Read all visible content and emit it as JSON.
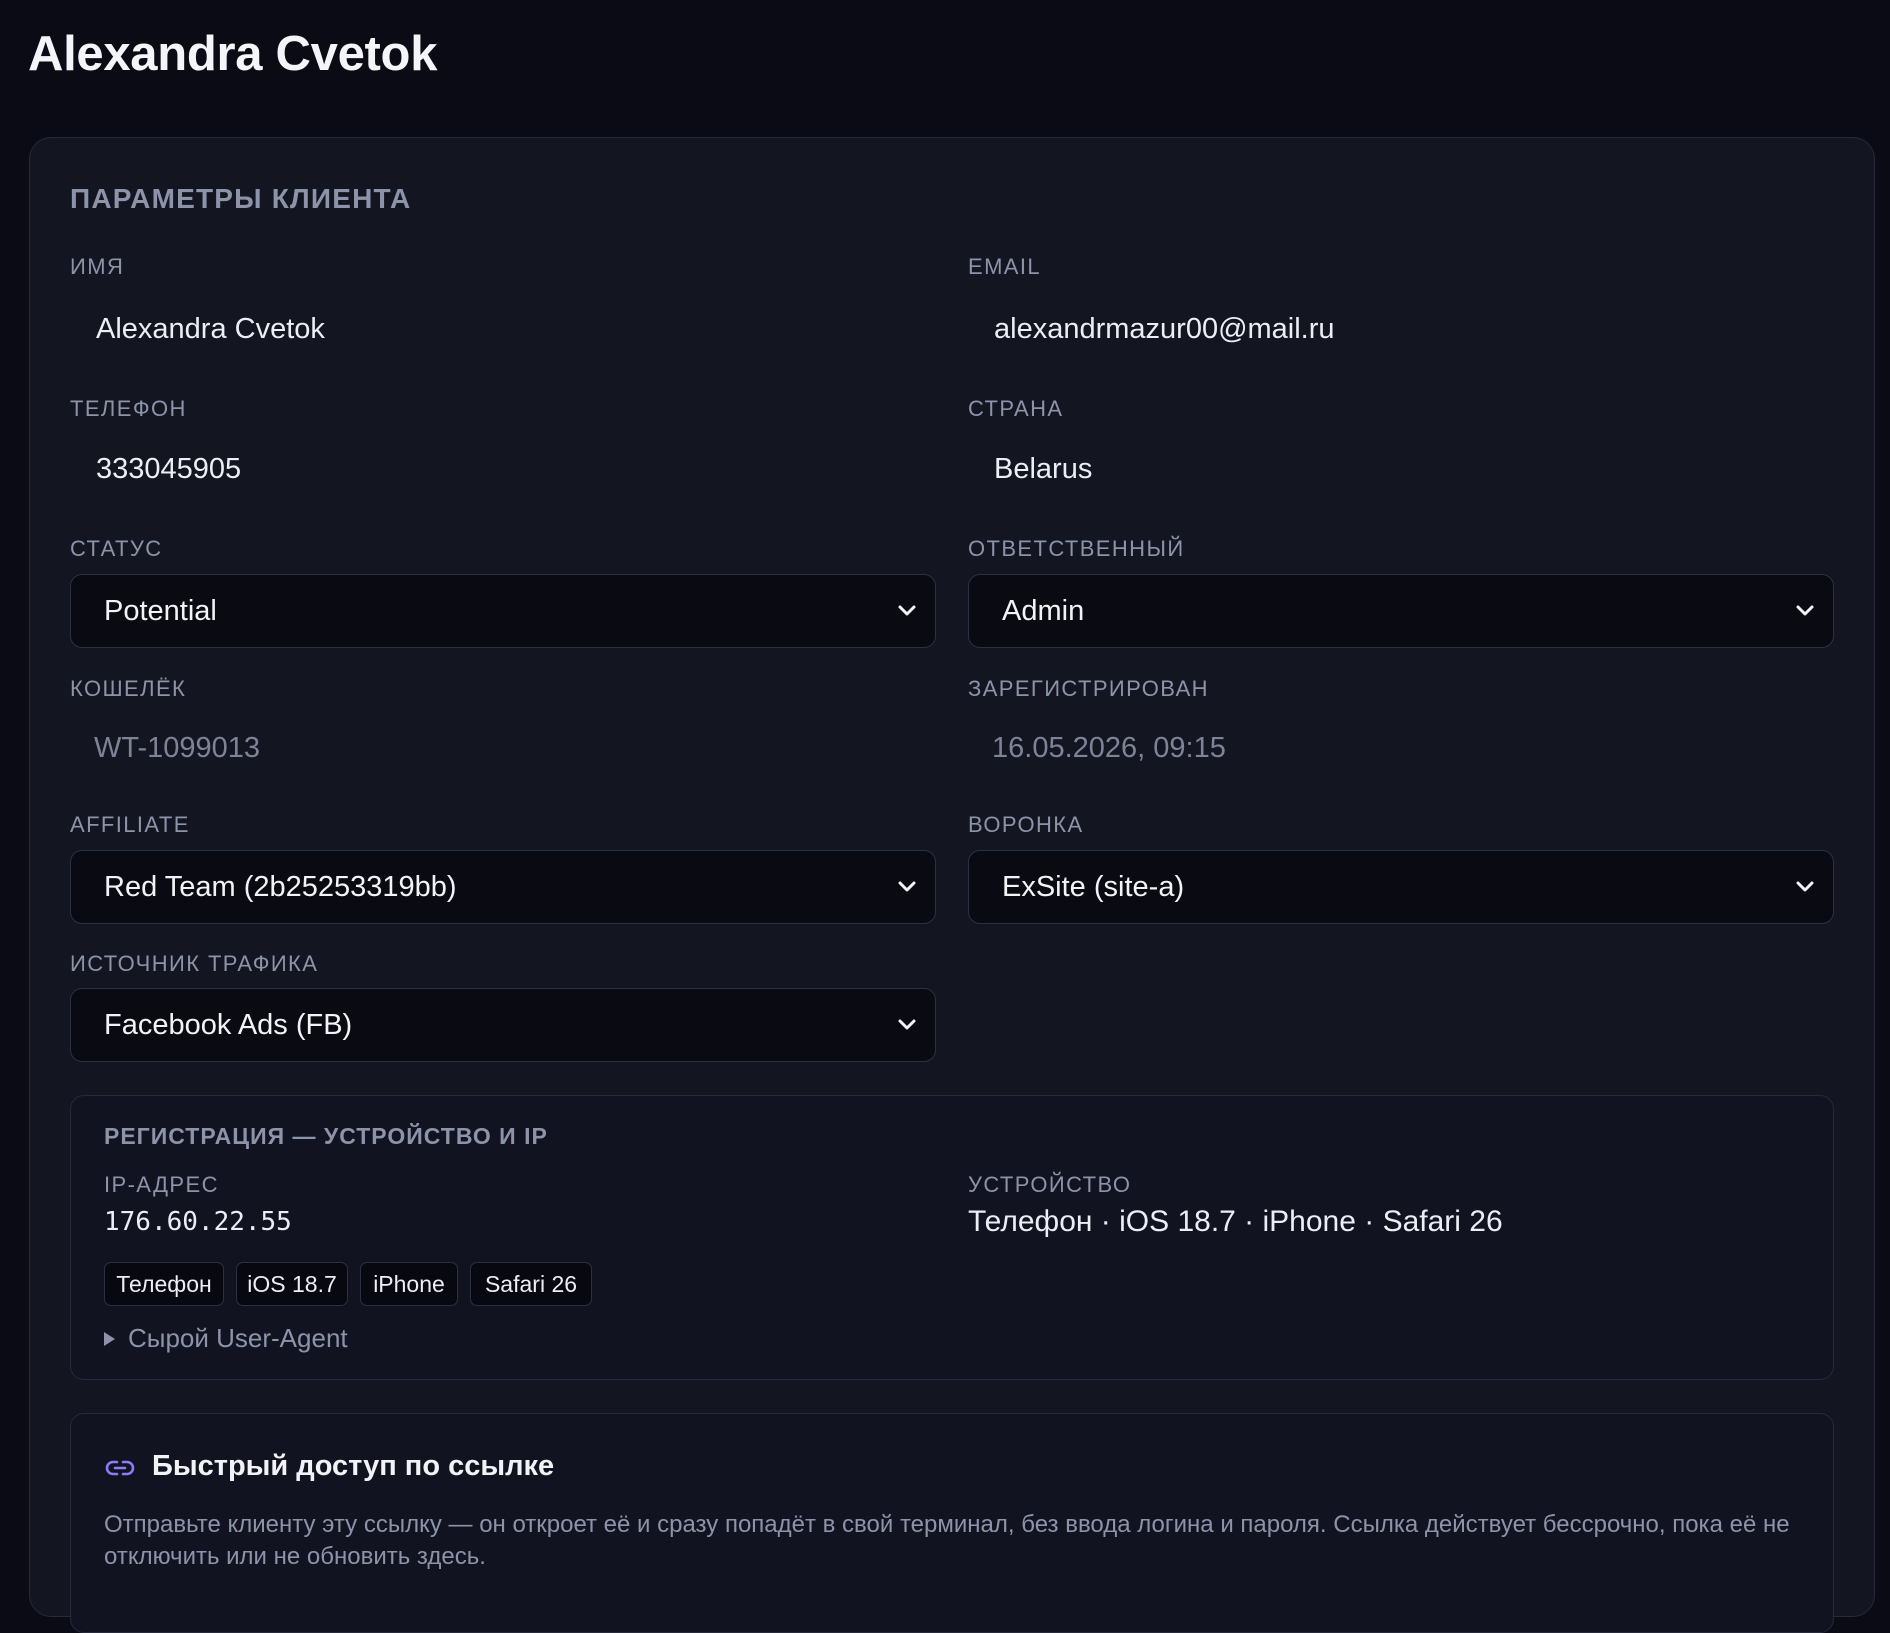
{
  "page": {
    "title": "Alexandra Cvetok"
  },
  "client_params": {
    "section_title": "ПАРАМЕТРЫ КЛИЕНТА",
    "name": {
      "label": "ИМЯ",
      "value": "Alexandra Cvetok"
    },
    "email": {
      "label": "EMAIL",
      "value": "alexandrmazur00@mail.ru"
    },
    "phone": {
      "label": "ТЕЛЕФОН",
      "value": "333045905"
    },
    "country": {
      "label": "СТРАНА",
      "value": "Belarus"
    },
    "status": {
      "label": "СТАТУС",
      "selected": "Potential"
    },
    "responsible": {
      "label": "ОТВЕТСТВЕННЫЙ",
      "selected": "Admin"
    },
    "wallet": {
      "label": "КОШЕЛЁК",
      "value": "WT-1099013"
    },
    "registered": {
      "label": "ЗАРЕГИСТРИРОВАН",
      "value": "16.05.2026, 09:15"
    },
    "affiliate": {
      "label": "AFFILIATE",
      "selected": "Red Team (2b25253319bb)"
    },
    "funnel": {
      "label": "ВОРОНКА",
      "selected": "ExSite (site-a)"
    },
    "traffic_source": {
      "label": "ИСТОЧНИК ТРАФИКА",
      "selected": "Facebook Ads (FB)"
    }
  },
  "registration": {
    "title": "РЕГИСТРАЦИЯ — УСТРОЙСТВО И IP",
    "ip_label": "IP-АДРЕС",
    "ip_value": "176.60.22.55",
    "device_label": "УСТРОЙСТВО",
    "device_value": "Телефон · iOS 18.7 · iPhone · Safari 26",
    "chips": [
      "Телефон",
      "iOS 18.7",
      "iPhone",
      "Safari 26"
    ],
    "raw_ua_toggle": "Сырой User-Agent"
  },
  "quick_link": {
    "icon": "link-icon",
    "title": "Быстрый доступ по ссылке",
    "description": "Отправьте клиенту эту ссылку — он откроет её и сразу попадёт в свой терминал, без ввода логина и пароля. Ссылка действует бессрочно, пока её не отключить или не обновить здесь."
  },
  "colors": {
    "background": "#0a0b14",
    "card": "#131521",
    "accent_link_icon": "#8b7cf6",
    "muted_text": "#8d93a8"
  }
}
